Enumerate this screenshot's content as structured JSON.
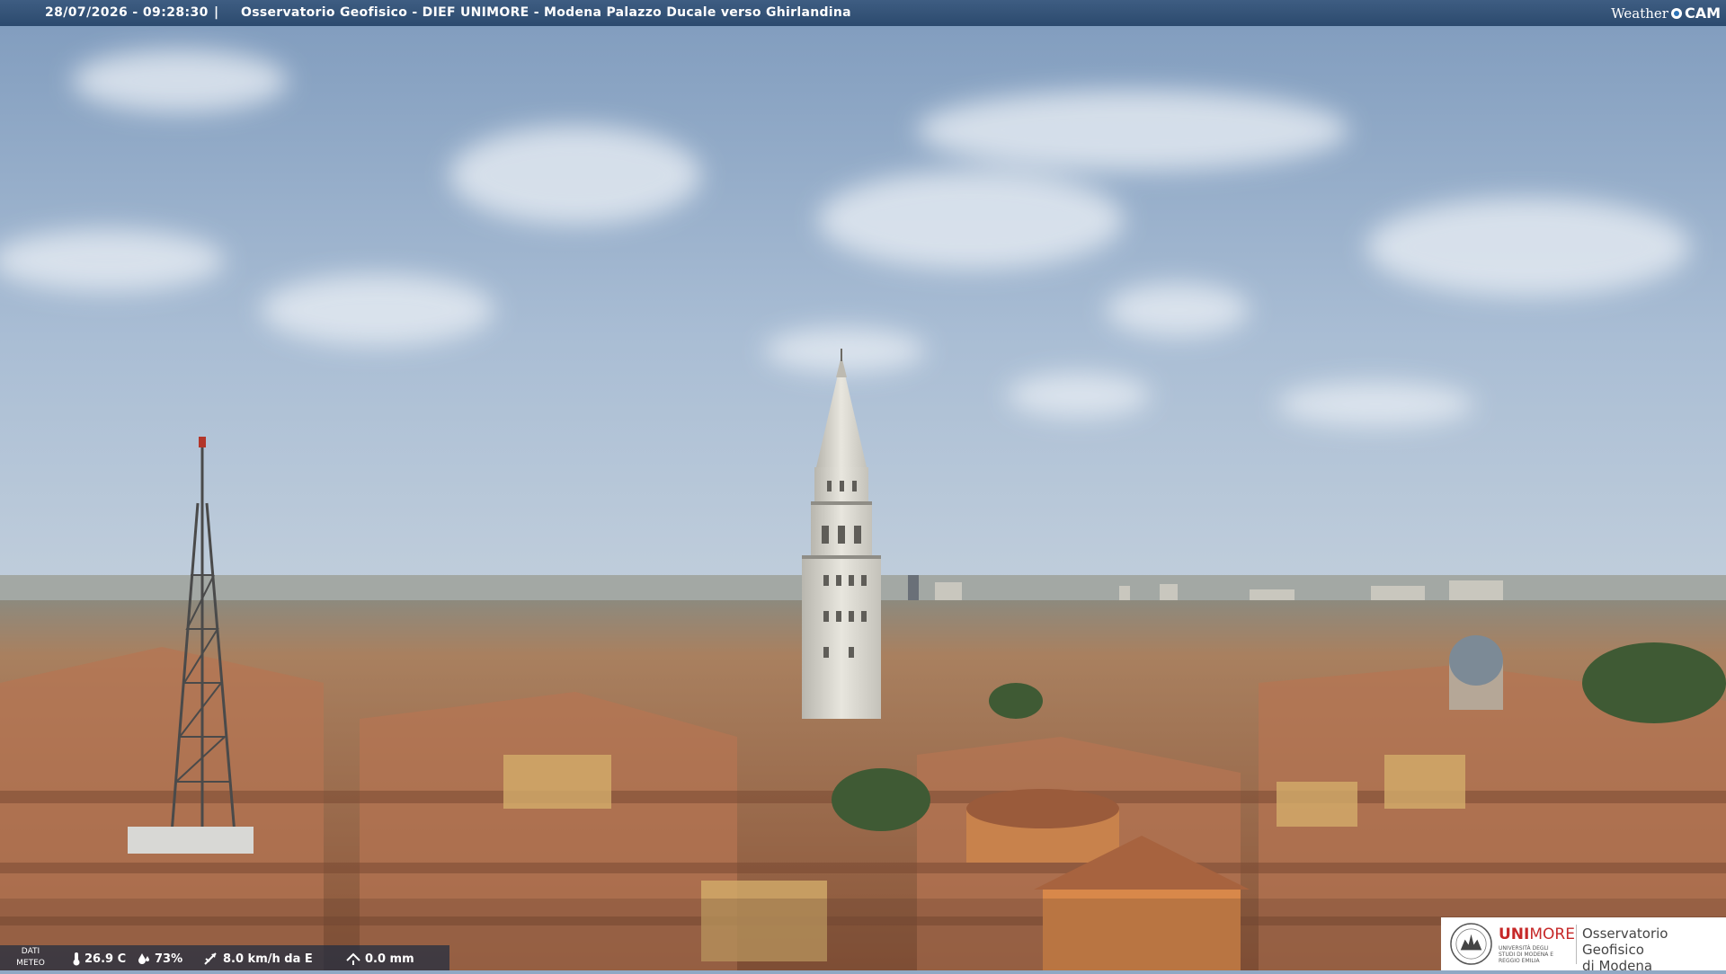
{
  "header": {
    "timestamp": "28/07/2026 - 09:28:30",
    "separator": "|",
    "caption": "Osservatorio Geofisico - DIEF UNIMORE - Modena Palazzo Ducale verso Ghirlandina",
    "logo_word1": "Weather",
    "logo_word2": "CAM"
  },
  "meteo": {
    "label_line1": "DATI",
    "label_line2": "METEO",
    "temperature": "26.9 C",
    "humidity": "73%",
    "wind": "8.0 km/h da E",
    "rain": "0.0 mm"
  },
  "footer_logo": {
    "brand_red": "UNI",
    "brand_rest": "MORE",
    "university_subtitle": "UNIVERSITÀ DEGLI STUDI DI MODENA E REGGIO EMILIA",
    "observatory_line1": "Osservatorio Geofisico",
    "observatory_line2": "di Modena",
    "brand_color": "#c62828"
  },
  "colors": {
    "header_bar": "#2c4a6e",
    "sky": "#9fb6d2",
    "roofs": "#a86a4a"
  }
}
